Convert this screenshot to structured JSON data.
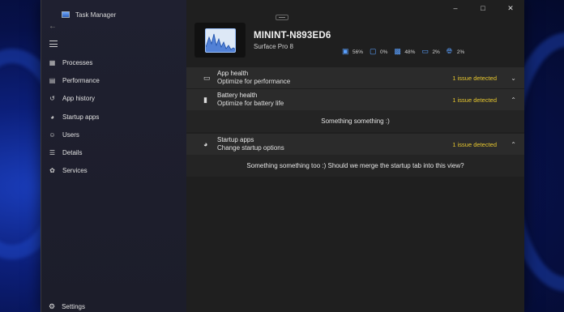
{
  "app": {
    "title": "Task Manager"
  },
  "sidebar": {
    "items": [
      {
        "label": "Processes",
        "icon": "grid-icon"
      },
      {
        "label": "Performance",
        "icon": "chart-icon"
      },
      {
        "label": "App history",
        "icon": "history-icon"
      },
      {
        "label": "Startup apps",
        "icon": "speedometer-icon"
      },
      {
        "label": "Users",
        "icon": "users-icon"
      },
      {
        "label": "Details",
        "icon": "list-icon"
      },
      {
        "label": "Services",
        "icon": "puzzle-icon"
      }
    ],
    "settings": {
      "label": "Settings",
      "icon": "gear-icon"
    }
  },
  "header": {
    "device_name": "MININT-N893ED6",
    "device_model": "Surface Pro 8",
    "stats": [
      {
        "icon": "cpu-icon",
        "value": "56%"
      },
      {
        "icon": "memory-chip-icon",
        "value": "0%"
      },
      {
        "icon": "ram-icon",
        "value": "48%"
      },
      {
        "icon": "disk-icon",
        "value": "2%"
      },
      {
        "icon": "network-icon",
        "value": "2%"
      }
    ]
  },
  "sections": {
    "app_health": {
      "title": "App health",
      "subtitle": "Optimize for performance",
      "status": "1 issue detected"
    },
    "battery_health": {
      "title": "Battery health",
      "subtitle": "Optimize for battery life",
      "status": "1 issue detected",
      "body": "Something something :)"
    },
    "startup_apps": {
      "title": "Startup apps",
      "subtitle": "Change startup options",
      "status": "1 issue detected",
      "body": "Something something too :) Should we merge the startup tab into this view?"
    }
  },
  "colors": {
    "accent": "#5aa0ff",
    "warning": "#e7c72f",
    "wallpaper": "#0c1f7a"
  }
}
